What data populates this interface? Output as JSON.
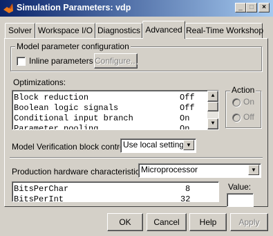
{
  "window": {
    "title": "Simulation Parameters: vdp"
  },
  "caption_buttons": {
    "minimize": "_",
    "maximize": "□",
    "close": "×"
  },
  "tabs": [
    {
      "label": "Solver"
    },
    {
      "label": "Workspace I/O"
    },
    {
      "label": "Diagnostics"
    },
    {
      "label": "Advanced"
    },
    {
      "label": "Real-Time Workshop"
    }
  ],
  "active_tab": "Advanced",
  "model_config": {
    "group_label": "Model parameter configuration",
    "inline_label": "Inline parameters",
    "inline_checked": false,
    "configure_label": "Configure..."
  },
  "optimizations": {
    "label": "Optimizations:",
    "items": [
      {
        "name": "Block reduction",
        "value": "Off"
      },
      {
        "name": "Boolean logic signals",
        "value": "Off"
      },
      {
        "name": "Conditional input branch",
        "value": "On"
      },
      {
        "name": "Parameter pooling",
        "value": "On"
      }
    ]
  },
  "action": {
    "label": "Action",
    "on_label": "On",
    "off_label": "Off"
  },
  "verification": {
    "label": "Model Verification block control:",
    "value": "Use local settings"
  },
  "production": {
    "label": "Production hardware characteristics:",
    "value": "Microprocessor"
  },
  "hardware_list": [
    {
      "name": "BitsPerChar",
      "value": "8"
    },
    {
      "name": "BitsPerInt",
      "value": "32"
    }
  ],
  "value_field": {
    "label": "Value:",
    "value": ""
  },
  "buttons": {
    "ok": "OK",
    "cancel": "Cancel",
    "help": "Help",
    "apply": "Apply"
  },
  "icons": {
    "app": "matlab-logo-icon",
    "checkbox": "checkbox-icon",
    "radio": "radio-icon",
    "dropdown": "chevron-down-icon",
    "scroll_up": "scroll-up-icon",
    "scroll_down": "scroll-down-icon"
  }
}
